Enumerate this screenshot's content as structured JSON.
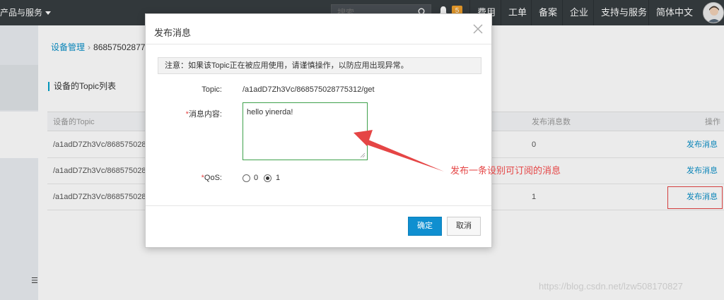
{
  "topbar": {
    "products_label": "产品与服务",
    "search_placeholder": "搜索",
    "notification_count": "5",
    "nav": [
      "费用",
      "工单",
      "备案",
      "企业",
      "支持与服务",
      "简体中文"
    ]
  },
  "page": {
    "breadcrumb_root": "设备管理",
    "breadcrumb_current": "86857502877",
    "section_title": "设备的Topic列表"
  },
  "table": {
    "headers": {
      "topic": "设备的Topic",
      "count": "发布消息数",
      "action": "操作"
    },
    "rows": [
      {
        "topic": "/a1adD7Zh3Vc/86857502877",
        "count": "0",
        "action": "发布消息"
      },
      {
        "topic": "/a1adD7Zh3Vc/86857502877",
        "count": "",
        "action": "发布消息"
      },
      {
        "topic": "/a1adD7Zh3Vc/86857502877",
        "count": "1",
        "action": "发布消息"
      }
    ]
  },
  "modal": {
    "title": "发布消息",
    "notice": "注意：如果该Topic正在被应用使用，请谨慎操作，以防应用出现异常。",
    "topic_label": "Topic:",
    "topic_value": "/a1adD7Zh3Vc/868575028775312/get",
    "content_label": "消息内容:",
    "content_required_mark": "*",
    "content_value": "hello yinerda!",
    "qos_label": "QoS:",
    "qos_required_mark": "*",
    "qos_options": [
      "0",
      "1"
    ],
    "qos_selected": "1",
    "ok_label": "确定",
    "cancel_label": "取消"
  },
  "annotation": {
    "text": "发布一条设别可订阅的消息",
    "color": "#e54545"
  },
  "watermark": "https://blog.csdn.net/lzw508170827",
  "colors": {
    "topbar": "#373d41",
    "link": "#0a90c8",
    "primary_button": "#0f8fd0",
    "badge": "#f0a02c",
    "textarea_border": "#3fa14b"
  }
}
